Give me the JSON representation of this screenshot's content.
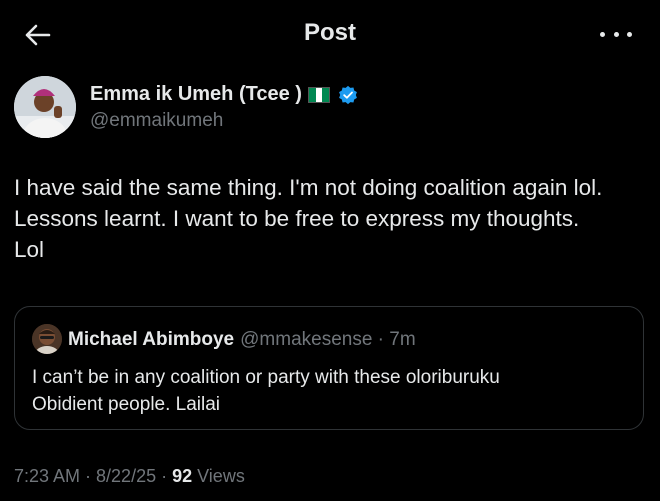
{
  "header": {
    "back_icon": "arrow-left-icon",
    "title": "Post",
    "more_icon": "more-horizontal-icon"
  },
  "author": {
    "display_name": "Emma ik Umeh (Tcee )",
    "flag": "Nigeria flag",
    "verified_icon": "verified-badge-icon",
    "verified_color": "#1d9bf0",
    "handle": "@emmaikumeh"
  },
  "tweet": {
    "lines": [
      "I have said the same thing. I'm not doing coalition again lol.",
      "Lessons learnt. I want to be free to express my thoughts.",
      "Lol"
    ]
  },
  "quote": {
    "display_name": "Michael Abimboye",
    "handle_time": "@mmakesense · 7m",
    "lines": [
      "I can’t be in any coalition or party with these oloriburuku",
      "Obidient people. Lailai"
    ]
  },
  "meta": {
    "time_date": "7:23 AM · 8/22/25 · ",
    "views_count": "92",
    "views_label": " Views"
  }
}
